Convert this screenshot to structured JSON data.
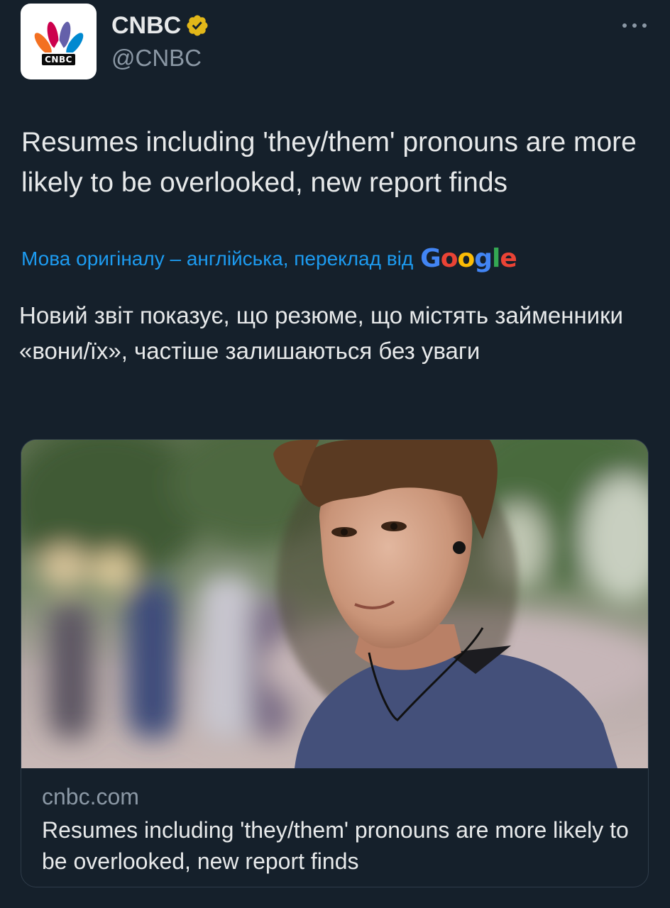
{
  "author": {
    "display_name": "CNBC",
    "handle": "@CNBC",
    "logo_text": "CNBC",
    "verified_icon": "verified-badge-icon",
    "verified_color": "#e2b719"
  },
  "tweet": {
    "text": "Resumes including 'they/them' pronouns are more likely to be overlooked, new report finds"
  },
  "translation": {
    "note": "Мова оригіналу – англійська, переклад від",
    "provider_letters": [
      "G",
      "o",
      "o",
      "g",
      "l",
      "e"
    ],
    "provider_colors": [
      "#4285f4",
      "#ea4335",
      "#fbbc05",
      "#4285f4",
      "#34a853",
      "#ea4335"
    ],
    "text": "Новий звіт показує, що резюме, що містять займенники «вони/їх», частіше залишаються без уваги"
  },
  "card": {
    "domain": "cnbc.com",
    "title": "Resumes including 'they/them' pronouns are more likely to be overlooked, new report finds"
  },
  "colors": {
    "background": "#15202b",
    "text": "#e7e9ea",
    "secondary": "#8b98a5",
    "link": "#1d9bf0",
    "border": "#2f3c4a"
  }
}
